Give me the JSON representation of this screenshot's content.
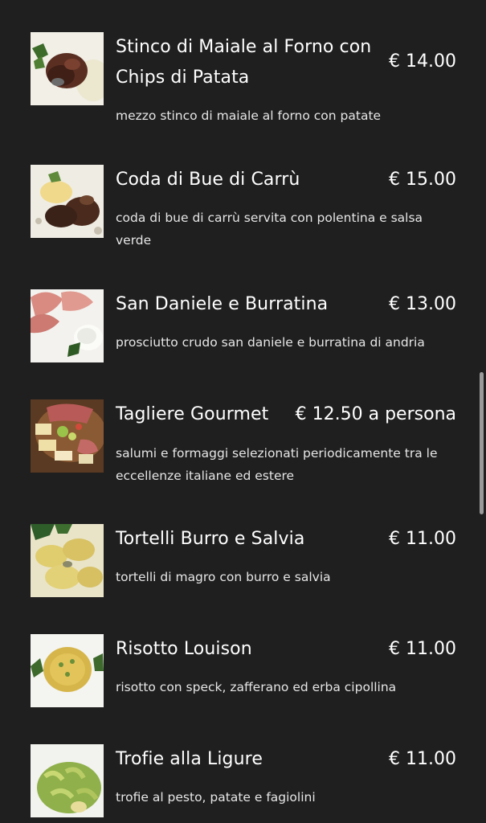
{
  "menu": {
    "items": [
      {
        "title_line1": "Stinco di Maiale al Forno con",
        "title_line2": "Chips di Patata",
        "price": "€ 14.00",
        "description": "mezzo stinco di maiale al forno con patate",
        "image_icon": "pork-shank-photo"
      },
      {
        "title_line1": "Coda di Bue di Carrù",
        "price": "€ 15.00",
        "description_line1": "coda di bue di carrù servita con polentina e salsa",
        "description_line2": "verde",
        "image_icon": "oxtail-photo"
      },
      {
        "title_line1": "San Daniele e Burratina",
        "price": "€ 13.00",
        "description": "prosciutto crudo san daniele e burratina di andria",
        "image_icon": "prosciutto-burrata-photo"
      },
      {
        "title_line1": "Tagliere Gourmet",
        "price": "€ 12.50 a persona",
        "description_line1": "salumi e formaggi selezionati periodicamente tra le",
        "description_line2": "eccellenze italiane ed estere",
        "image_icon": "charcuterie-board-photo"
      },
      {
        "title_line1": "Tortelli Burro e Salvia",
        "price": "€ 11.00",
        "description": "tortelli di magro con burro e salvia",
        "image_icon": "tortelli-photo"
      },
      {
        "title_line1": "Risotto Louison",
        "price": "€ 11.00",
        "description": "risotto con speck, zafferano ed erba cipollina",
        "image_icon": "risotto-photo"
      },
      {
        "title_line1": "Trofie alla Ligure",
        "price": "€ 11.00",
        "description": "trofie al pesto, patate e fagiolini",
        "image_icon": "trofie-pesto-photo"
      }
    ]
  },
  "colors": {
    "background": "#1f1f1f",
    "text": "#ffffff",
    "description_text": "#e6e6e6",
    "scrollbar": "#9a9a9a"
  }
}
